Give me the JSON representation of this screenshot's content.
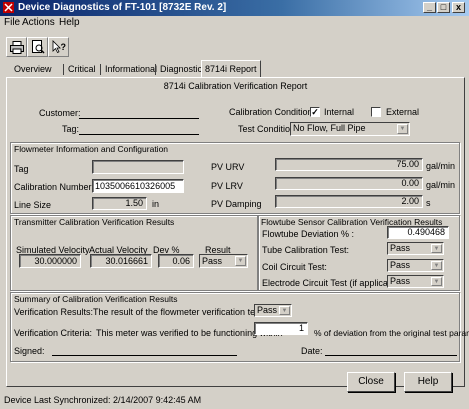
{
  "window": {
    "title": "Device Diagnostics of FT-101 [8732E Rev. 2]",
    "minimize": "_",
    "maximize": "□",
    "close": "x"
  },
  "menu": [
    "File",
    "Actions",
    "Help"
  ],
  "toolbar": {
    "icons": [
      "print-icon",
      "print-preview-icon",
      "help-pointer-icon"
    ]
  },
  "tabs": [
    "Overview",
    "Critical",
    "Informational",
    "Diagnostics",
    "8714i Report"
  ],
  "report": {
    "heading": "8714i Calibration Verification Report",
    "customer_label": "Customer:",
    "tag_label": "Tag:",
    "cal_conditions_label": "Calibration Conditions:",
    "internal_label": "Internal",
    "internal_checked": true,
    "external_label": "External",
    "external_checked": false,
    "test_conditions_label": "Test Conditions:",
    "test_conditions_value": "No Flow, Full Pipe"
  },
  "flowmeter": {
    "title": "Flowmeter Information and Configuration",
    "tag_label": "Tag",
    "tag_value": "",
    "cal_number_label": "Calibration Number",
    "cal_number_value": "1035006610326005",
    "line_size_label": "Line Size",
    "line_size_value": "1.50",
    "line_size_unit": "in",
    "pv_urv_label": "PV URV",
    "pv_urv_value": "75.00",
    "pv_urv_unit": "gal/min",
    "pv_lrv_label": "PV LRV",
    "pv_lrv_value": "0.00",
    "pv_lrv_unit": "gal/min",
    "pv_damping_label": "PV Damping",
    "pv_damping_value": "2.00",
    "pv_damping_unit": "s"
  },
  "transmitter": {
    "title": "Transmitter Calibration Verification Results",
    "sim_vel_label": "Simulated Velocity",
    "act_vel_label": "Actual Velocity",
    "dev_label": "Dev %",
    "result_label": "Result",
    "sim_vel_value": "30.000000",
    "act_vel_value": "30.016661",
    "dev_value": "0.06",
    "result_value": "Pass"
  },
  "flowtube": {
    "title": "Flowtube Sensor Calibration Verification Results",
    "deviation_label": "Flowtube Deviation % :",
    "deviation_value": "0.490468",
    "tube_cal_label": "Tube Calibration Test:",
    "tube_cal_value": "Pass",
    "coil_label": "Coil Circuit Test:",
    "coil_value": "Pass",
    "electrode_label": "Electrode Circuit Test (if applicable):",
    "electrode_value": "Pass"
  },
  "summary": {
    "title": "Summary of Calibration Verification Results",
    "verification_results_label": "Verification Results:",
    "verification_results_text": "The result of the flowmeter verification test is:",
    "verification_result_value": "Pass",
    "criteria_label": "Verification Criteria:",
    "criteria_text": "This meter was verified to be functioning within",
    "criteria_value": "1",
    "criteria_suffix": "% of deviation from the original test parameters",
    "signed_label": "Signed:",
    "date_label": "Date:"
  },
  "buttons": {
    "close": "Close",
    "help": "Help"
  },
  "status": "Device Last Synchronized: 2/14/2007 9:42:45 AM"
}
